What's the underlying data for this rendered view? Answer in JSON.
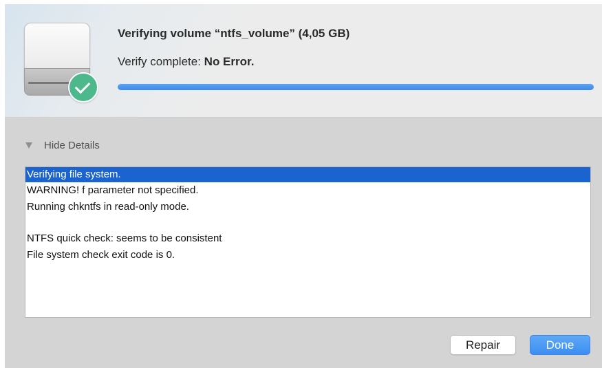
{
  "dialog": {
    "title": "Verifying volume “ntfs_volume” (4,05 GB)",
    "status_prefix": "Verify complete: ",
    "status_result": "No Error.",
    "progress_fraction": 1.0,
    "accent_color": "#3e8ae6",
    "success_color": "#4cb88b",
    "icon": "drive-with-checkmark-icon"
  },
  "details": {
    "toggle_label": "Hide Details",
    "log_lines": [
      "Verifying file system.",
      "WARNING!  f parameter not specified.",
      "Running chkntfs in read-only mode.",
      "",
      "NTFS quick check: seems to be consistent",
      "File system check exit code is 0."
    ],
    "selected_line": 0,
    "selection_color": "#1b64d0"
  },
  "buttons": {
    "repair_label": "Repair",
    "done_label": "Done"
  }
}
